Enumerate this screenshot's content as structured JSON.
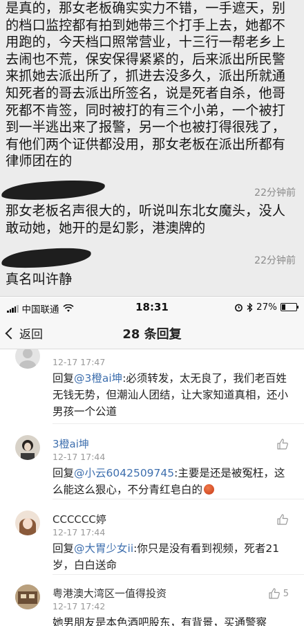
{
  "chat": {
    "message1": "是真的，那女老板确实实力不错，一手遮天，别的档口监控都有拍到她带三个打手上去，她都不用跑的，今天档口照常营业，十三行一帮老乡上去闹也不荒，保安保得紧紧的，后来派出所民警来抓她去派出所了，抓进去没多久，派出所就通知死者的哥去派出所签名，说是死者自杀，他哥死都不肯签，同时被打的有三个小弟，一个被打到一半逃出来了报警，另一个也被打得很残了，有他们两个证供都没用，那女老板在派出所都有律师团在的",
    "time1": "22分钟前",
    "message2": "那女老板名声很大的，听说叫东北女魔头，没人敢动她，她开的是幻影，港澳牌的",
    "time2": "22分钟前",
    "message3": "真名叫许静"
  },
  "statusbar": {
    "carrier": "中国联通",
    "time": "18:31",
    "battery": "27%",
    "battery_level": 0.27
  },
  "navbar": {
    "back_label": "返回",
    "title": "28 条回复"
  },
  "comments": [
    {
      "name": "",
      "time": "12-17 17:47",
      "reply_prefix": "回复",
      "mention": "@3橙ai坤",
      "text": ":必须转发，太无良了，我们老百姓无钱无势，但潮汕人团结，让大家知道真相，还小男孩一个公道"
    },
    {
      "name": "3橙ai坤",
      "time": "12-17 17:44",
      "reply_prefix": "回复",
      "mention": "@小云6042509745",
      "text": ":主要是还是被冤枉，这么能这么狠心，不分青红皂白的"
    },
    {
      "name": "CCCCCC婷",
      "time": "12-17 17:44",
      "reply_prefix": "回复",
      "mention": "@大胃少女ii",
      "text": ":你只是没有看到视频，死者21岁，白白送命"
    },
    {
      "name": "粤港澳大湾区一值得投资",
      "time": "12-17 17:42",
      "likes": "5",
      "text": "她男朋友是本色酒吧股东，有背景，买通警察"
    }
  ],
  "colors": {
    "link_blue": "#3e6fae",
    "chat_bg": "#ececec"
  }
}
